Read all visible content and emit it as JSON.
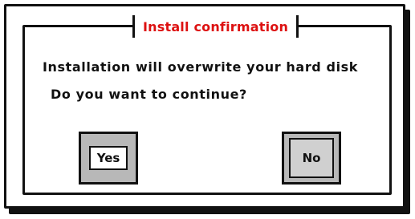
{
  "dialog": {
    "title": "Install confirmation",
    "message_line1": "Installation will overwrite your hard disk",
    "message_line2": "Do you want to continue?",
    "buttons": {
      "yes": "Yes",
      "no": "No"
    },
    "colors": {
      "title": "#dd1111",
      "border": "#111111",
      "button_bg": "#b8b8b8",
      "background": "#ffffff"
    }
  }
}
